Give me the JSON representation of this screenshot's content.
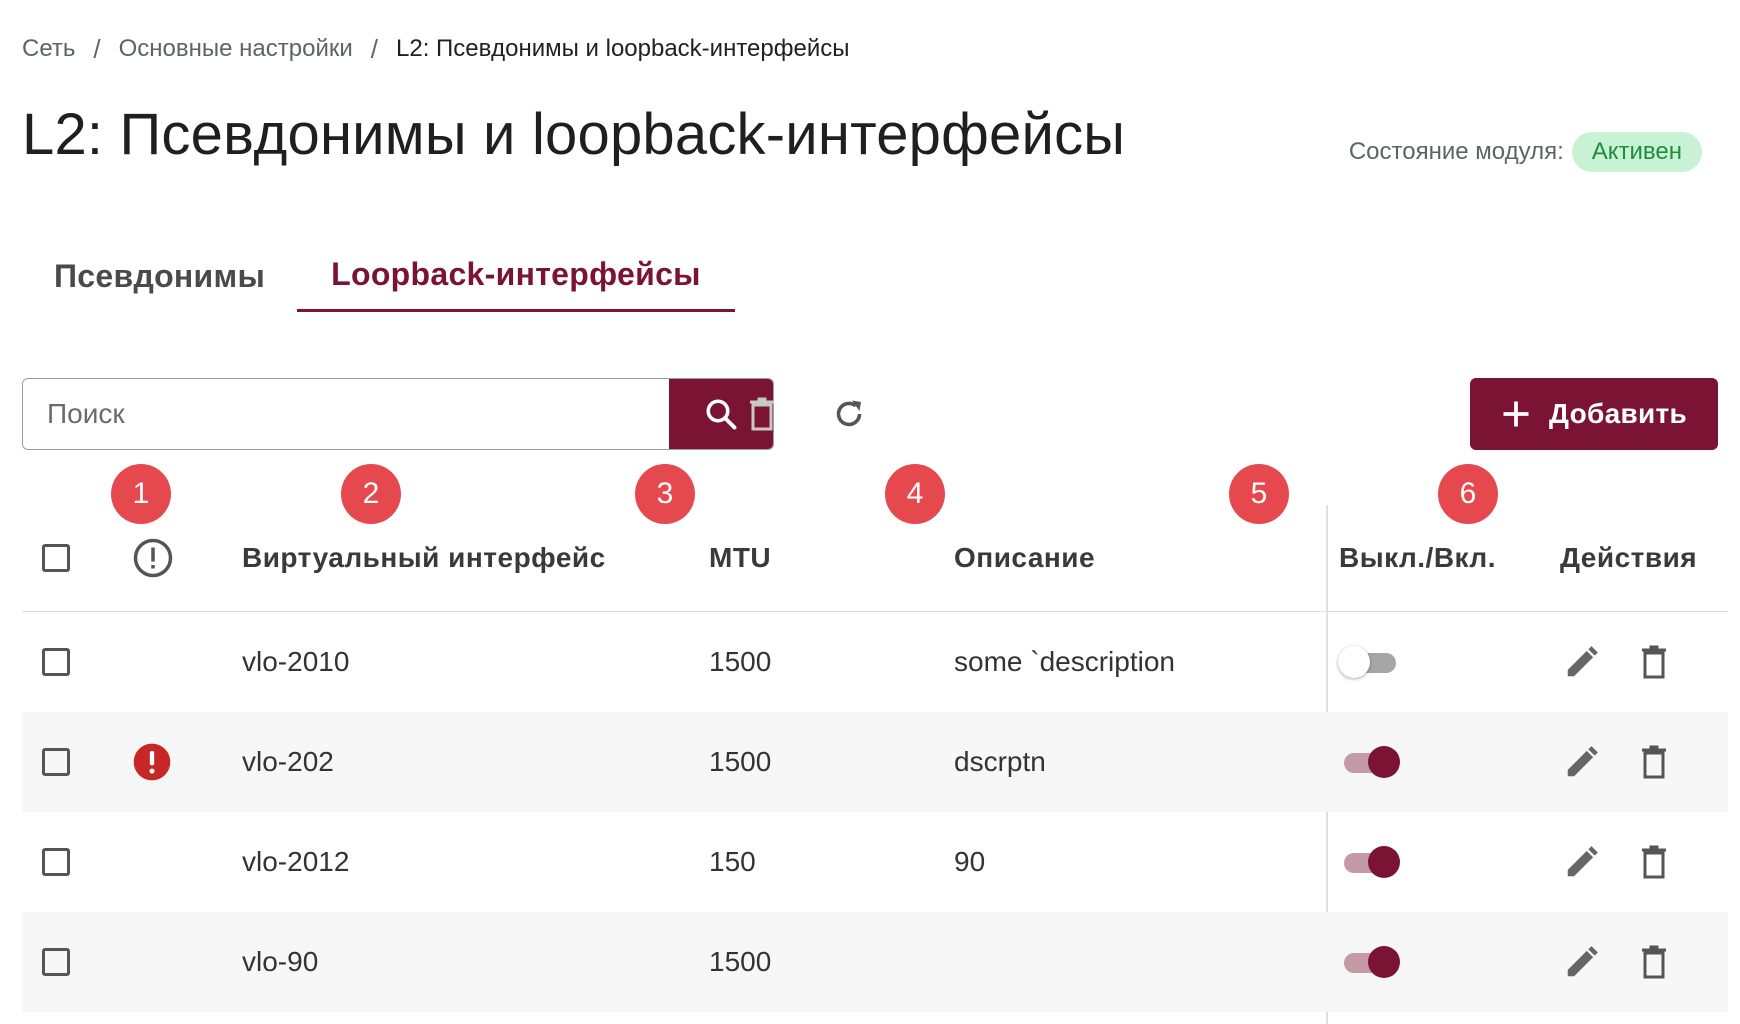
{
  "breadcrumb": {
    "items": [
      "Сеть",
      "Основные настройки",
      "L2: Псевдонимы и loopback-интерфейсы"
    ],
    "separator": "/"
  },
  "page": {
    "title": "L2: Псевдонимы и loopback-интерфейсы"
  },
  "module_state": {
    "label": "Состояние модуля:",
    "value": "Активен",
    "badge_color": "#c9f2d5",
    "text_color": "#1e8e3e"
  },
  "tabs": [
    {
      "label": "Псевдонимы",
      "active": false
    },
    {
      "label": "Loopback-интерфейсы",
      "active": true
    }
  ],
  "toolbar": {
    "search_placeholder": "Поиск",
    "search_icon": "search-icon",
    "delete_icon": "trash-icon",
    "refresh_icon": "refresh-icon",
    "add_label": "Добавить",
    "accent_color": "#7b1434"
  },
  "markers": [
    "1",
    "2",
    "3",
    "4",
    "5",
    "6"
  ],
  "table": {
    "headers": {
      "status_icon": "alert-circle-icon",
      "name": "Виртуальный интерфейс",
      "mtu": "MTU",
      "description": "Описание",
      "toggle": "Выкл./Вкл.",
      "actions": "Действия"
    },
    "rows": [
      {
        "name": "vlo-2010",
        "mtu": "1500",
        "description": "some `description",
        "enabled": false,
        "error": false
      },
      {
        "name": "vlo-202",
        "mtu": "1500",
        "description": "dscrptn",
        "enabled": true,
        "error": true
      },
      {
        "name": "vlo-2012",
        "mtu": "150",
        "description": "90",
        "enabled": true,
        "error": false
      },
      {
        "name": "vlo-90",
        "mtu": "1500",
        "description": "",
        "enabled": true,
        "error": false
      }
    ]
  }
}
